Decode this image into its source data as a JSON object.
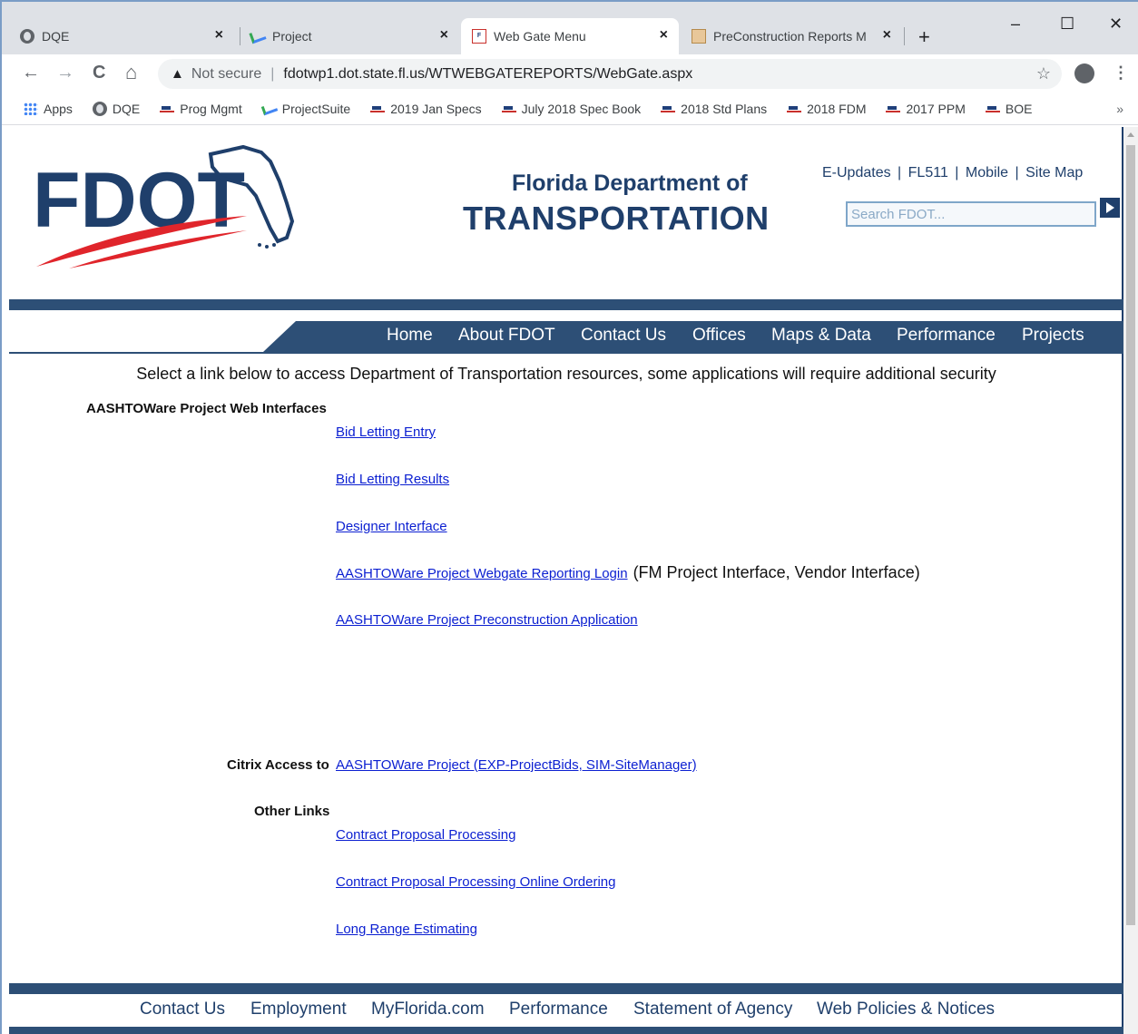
{
  "browser": {
    "tabs": [
      {
        "title": "DQE",
        "icon": "globe-icon",
        "active": false
      },
      {
        "title": "Project",
        "icon": "projectsuite-icon",
        "active": false
      },
      {
        "title": "Web Gate Menu",
        "icon": "fdot-favicon",
        "active": true
      },
      {
        "title": "PreConstruction Reports M",
        "icon": "report-favicon",
        "active": false
      }
    ],
    "new_tab": "+",
    "window_controls": {
      "minimize": "–",
      "maximize": "☐",
      "close": "✕"
    },
    "nav": {
      "back": "←",
      "forward": "→",
      "reload": "C",
      "home": "⌂"
    },
    "address": {
      "security_icon": "▲",
      "security_text": "Not secure",
      "url": "fdotwp1.dot.state.fl.us/WTWEBGATEREPORTS/WebGate.aspx",
      "bookmark_star": "☆"
    },
    "menu": "⋮",
    "bookmarks": [
      {
        "label": "Apps",
        "icon": "apps-icon"
      },
      {
        "label": "DQE",
        "icon": "globe-icon"
      },
      {
        "label": "Prog Mgmt",
        "icon": "fdot-favicon"
      },
      {
        "label": "ProjectSuite",
        "icon": "projectsuite-icon"
      },
      {
        "label": "2019 Jan Specs",
        "icon": "fdot-favicon"
      },
      {
        "label": "July 2018 Spec Book",
        "icon": "fdot-favicon"
      },
      {
        "label": "2018 Std Plans",
        "icon": "fdot-favicon"
      },
      {
        "label": "2018 FDM",
        "icon": "fdot-favicon"
      },
      {
        "label": "2017 PPM",
        "icon": "fdot-favicon"
      },
      {
        "label": "BOE",
        "icon": "fdot-favicon"
      }
    ],
    "bookmarks_overflow": "»"
  },
  "header": {
    "logo_text": "FDOT",
    "org_line1": "Florida Department of",
    "org_line2": "TRANSPORTATION",
    "utility_links": [
      "E-Updates",
      "FL511",
      "Mobile",
      "Site Map"
    ],
    "utility_sep": "|",
    "search_placeholder": "Search FDOT..."
  },
  "nav_menu": [
    "Home",
    "About FDOT",
    "Contact Us",
    "Offices",
    "Maps & Data",
    "Performance",
    "Projects"
  ],
  "content": {
    "intro": "Select a link below to access Department of Transportation resources, some applications will require additional security",
    "aashto_heading": "AASHTOWare Project Web Interfaces",
    "aashto_links": [
      "Bid Letting Entry",
      "Bid Letting Results",
      "Designer Interface",
      "AASHTOWare Project Webgate Reporting Login",
      "AASHTOWare Project Preconstruction Application"
    ],
    "webgate_note": "(FM Project Interface, Vendor Interface)",
    "citrix_label": "Citrix Access to",
    "citrix_link": "AASHTOWare Project (EXP-ProjectBids, SIM-SiteManager)",
    "other_heading": "Other Links",
    "other_links": [
      "Contract Proposal Processing",
      "Contract Proposal Processing Online Ordering",
      "Long Range Estimating"
    ]
  },
  "footer": [
    "Contact Us",
    "Employment",
    "MyFlorida.com",
    "Performance",
    "Statement of Agency",
    "Web Policies & Notices"
  ],
  "colors": {
    "brand_navy": "#1f3f6b",
    "bar_blue": "#2d4f76",
    "brand_red": "#e0252b",
    "link": "#0b1fd1"
  }
}
